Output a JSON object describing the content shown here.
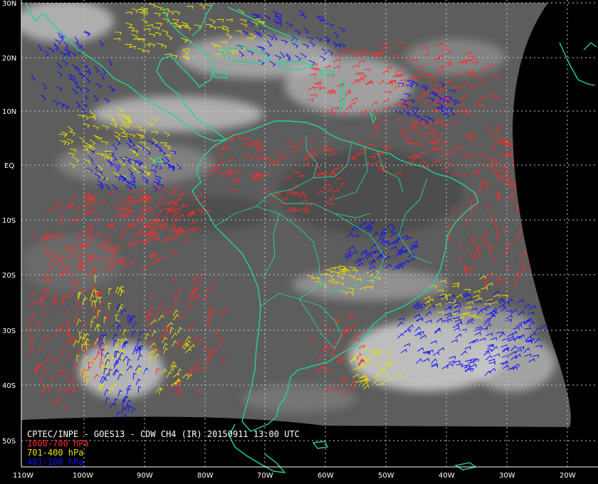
{
  "title": "CPTEC/INPE - GOES13 - CDW CH4 (IR) 20150911 13:00 UTC",
  "legend": [
    {
      "label": "1000-700 hPa",
      "color": "#ff2a2a"
    },
    {
      "label": "701-400 hPa",
      "color": "#e8e000"
    },
    {
      "label": "401-100 hPa",
      "color": "#1010ff"
    }
  ],
  "title_color": "#ffffff",
  "coast_color": "#22d49a",
  "grid_color": "#cccccc",
  "background_color": "#000000",
  "lat_labels": [
    "30N",
    "20N",
    "10N",
    "EQ",
    "10S",
    "20S",
    "30S",
    "40S",
    "50S"
  ],
  "lon_labels": [
    "110W",
    "100W",
    "90W",
    "80W",
    "70W",
    "60W",
    "50W",
    "40W",
    "30W",
    "20W"
  ]
}
